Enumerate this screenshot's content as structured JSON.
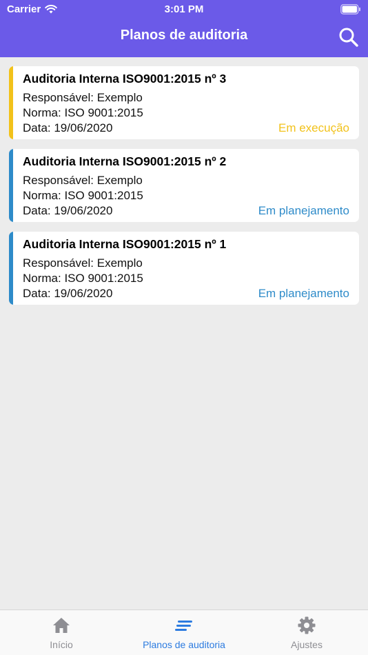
{
  "status_bar": {
    "carrier": "Carrier",
    "time": "3:01 PM"
  },
  "header": {
    "title": "Planos de auditoria",
    "search_icon": "search-icon"
  },
  "plans": [
    {
      "title": "Auditoria Interna ISO9001:2015 nº 3",
      "responsible": "Responsável: Exemplo",
      "norm": "Norma: ISO 9001:2015",
      "date": "Data: 19/06/2020",
      "status": "Em execução",
      "color": "#f2c21b"
    },
    {
      "title": "Auditoria Interna ISO9001:2015 nº 2",
      "responsible": "Responsável: Exemplo",
      "norm": "Norma: ISO 9001:2015",
      "date": "Data: 19/06/2020",
      "status": "Em planejamento",
      "color": "#2e8bc9"
    },
    {
      "title": "Auditoria Interna ISO9001:2015 nº 1",
      "responsible": "Responsável: Exemplo",
      "norm": "Norma: ISO 9001:2015",
      "date": "Data: 19/06/2020",
      "status": "Em planejamento",
      "color": "#2e8bc9"
    }
  ],
  "tabs": [
    {
      "label": "Início",
      "icon": "home-icon",
      "active": false
    },
    {
      "label": "Planos de auditoria",
      "icon": "list-icon",
      "active": true
    },
    {
      "label": "Ajustes",
      "icon": "gear-icon",
      "active": false
    }
  ],
  "colors": {
    "header": "#6b5ae8",
    "tab_active": "#2c7be0",
    "tab_inactive": "#8e8e93",
    "status_execution": "#f2c21b",
    "status_planning": "#2e8bc9"
  }
}
